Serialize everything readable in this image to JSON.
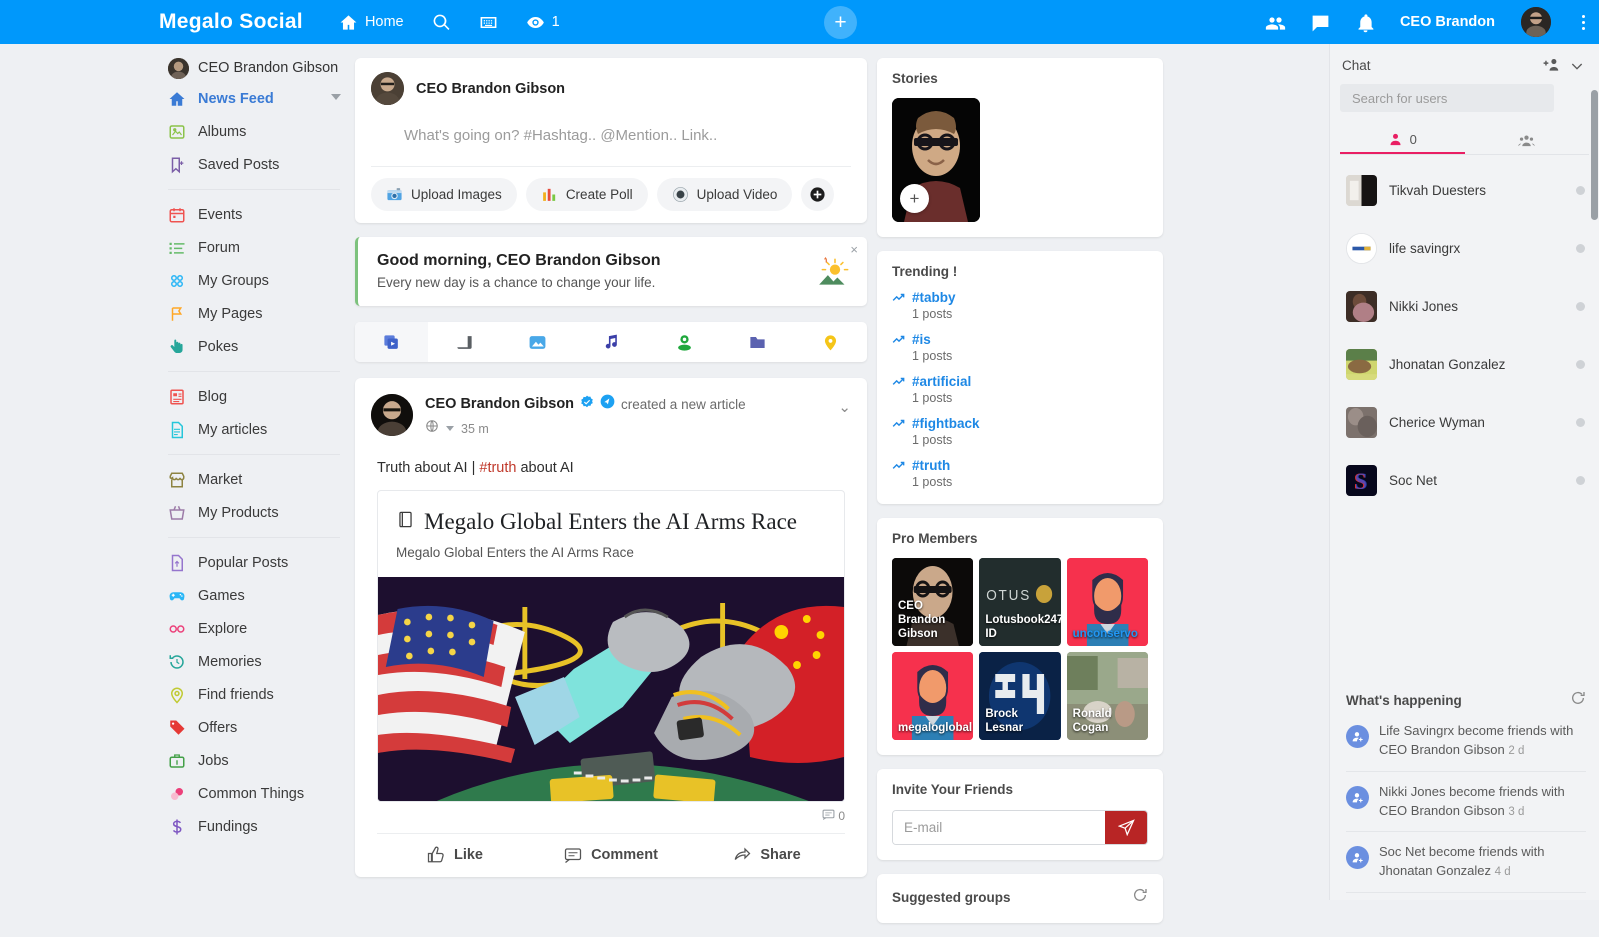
{
  "header": {
    "brand": "Megalo Social",
    "home_label": "Home",
    "search_icon": "search-icon",
    "keyboard_icon": "keyboard-icon",
    "eye_icon": "eye-icon",
    "eye_count": "1",
    "add_label": "+",
    "friends_icon": "friends-icon",
    "messages_icon": "messages-icon",
    "notifications_icon": "bell-icon",
    "user_name": "CEO Brandon",
    "accent_color": "#0098fb"
  },
  "sidebar": {
    "user": "CEO Brandon Gibson",
    "groups": [
      {
        "items": [
          {
            "label": "News Feed",
            "icon": "home-icon",
            "active": true,
            "color": "#3a7bd5"
          },
          {
            "label": "Albums",
            "icon": "albums-icon",
            "active": false,
            "color": "#8bc34a"
          },
          {
            "label": "Saved Posts",
            "icon": "bookmark-icon",
            "active": false,
            "color": "#7b5ea7"
          }
        ]
      },
      {
        "items": [
          {
            "label": "Events",
            "icon": "calendar-icon",
            "active": false,
            "color": "#ef5350"
          },
          {
            "label": "Forum",
            "icon": "list-icon",
            "active": false,
            "color": "#66bb6a"
          },
          {
            "label": "My Groups",
            "icon": "groups-icon",
            "active": false,
            "color": "#29b6f6"
          },
          {
            "label": "My Pages",
            "icon": "flag-icon",
            "active": false,
            "color": "#ffa726"
          },
          {
            "label": "Pokes",
            "icon": "hand-icon",
            "active": false,
            "color": "#26a69a"
          }
        ]
      },
      {
        "items": [
          {
            "label": "Blog",
            "icon": "blog-icon",
            "active": false,
            "color": "#ef5350"
          },
          {
            "label": "My articles",
            "icon": "article-icon",
            "active": false,
            "color": "#26c6da"
          }
        ]
      },
      {
        "items": [
          {
            "label": "Market",
            "icon": "market-icon",
            "active": false,
            "color": "#8d8341"
          },
          {
            "label": "My Products",
            "icon": "basket-icon",
            "active": false,
            "color": "#9c7ba8"
          }
        ]
      },
      {
        "items": [
          {
            "label": "Popular Posts",
            "icon": "popular-icon",
            "active": false,
            "color": "#9575cd"
          },
          {
            "label": "Games",
            "icon": "gamepad-icon",
            "active": false,
            "color": "#29b6f6"
          },
          {
            "label": "Explore",
            "icon": "explore-icon",
            "active": false,
            "color": "#ec407a"
          },
          {
            "label": "Memories",
            "icon": "memories-icon",
            "active": false,
            "color": "#26a69a"
          },
          {
            "label": "Find friends",
            "icon": "location-icon",
            "active": false,
            "color": "#c0ca33"
          },
          {
            "label": "Offers",
            "icon": "offers-icon",
            "active": false,
            "color": "#e53935"
          },
          {
            "label": "Jobs",
            "icon": "jobs-icon",
            "active": false,
            "color": "#43a047"
          },
          {
            "label": "Common Things",
            "icon": "common-icon",
            "active": false,
            "color": "#ec407a"
          },
          {
            "label": "Fundings",
            "icon": "dollar-icon",
            "active": false,
            "color": "#7e57c2"
          }
        ]
      }
    ]
  },
  "composer": {
    "user": "CEO Brandon Gibson",
    "placeholder": "What's going on? #Hashtag.. @Mention.. Link..",
    "tools": [
      {
        "label": "Upload Images",
        "icon": "camera-icon"
      },
      {
        "label": "Create Poll",
        "icon": "poll-icon"
      },
      {
        "label": "Upload Video",
        "icon": "video-icon"
      }
    ],
    "more_label": "+"
  },
  "greeting": {
    "title": "Good morning, CEO Brandon Gibson",
    "subtitle": "Every new day is a chance to change your life.",
    "close_label": "×",
    "icon": "sunrise-icon"
  },
  "feed_tabs": [
    {
      "icon": "all-posts-icon",
      "selected": true
    },
    {
      "icon": "text-post-icon",
      "selected": false
    },
    {
      "icon": "photo-icon",
      "selected": false
    },
    {
      "icon": "music-icon",
      "selected": false
    },
    {
      "icon": "live-icon",
      "selected": false
    },
    {
      "icon": "files-icon",
      "selected": false
    },
    {
      "icon": "map-pin-icon",
      "selected": false
    }
  ],
  "post": {
    "author": "CEO Brandon Gibson",
    "verified_icon": "verified-badge-icon",
    "pro_icon": "pro-badge-icon",
    "action": "created a new article",
    "privacy_icon": "globe-icon",
    "time": "35 m",
    "chevron": "⌄",
    "text_before": "Truth about AI | ",
    "hashtag": "#truth",
    "text_after": " about AI",
    "article_title": "Megalo Global Enters the AI Arms Race",
    "article_subtitle": "Megalo Global Enters the AI Arms Race",
    "article_icon": "book-icon",
    "comment_count": "0",
    "actions": [
      {
        "label": "Like",
        "icon": "thumbs-up-icon"
      },
      {
        "label": "Comment",
        "icon": "comment-icon"
      },
      {
        "label": "Share",
        "icon": "share-icon"
      }
    ]
  },
  "stories": {
    "title": "Stories",
    "add_label": "+"
  },
  "trending": {
    "title": "Trending !",
    "items": [
      {
        "tag": "#tabby",
        "count": "1 posts"
      },
      {
        "tag": "#is",
        "count": "1 posts"
      },
      {
        "tag": "#artificial",
        "count": "1 posts"
      },
      {
        "tag": "#fightback",
        "count": "1 posts"
      },
      {
        "tag": "#truth",
        "count": "1 posts"
      }
    ]
  },
  "pro_members": {
    "title": "Pro Members",
    "items": [
      {
        "name": "CEO Brandon Gibson",
        "bg": "#120f0d",
        "name_color": "white"
      },
      {
        "name": "Lotusbook247 ID",
        "bg": "#23302f",
        "name_color": "white"
      },
      {
        "name": "unconservo",
        "bg": "#f6314d",
        "name_color": "blue"
      },
      {
        "name": "megaloglobal",
        "bg": "#f6314d",
        "name_color": "white"
      },
      {
        "name": "Brock Lesnar",
        "bg": "#0d2a52",
        "name_color": "white"
      },
      {
        "name": "Ronald Cogan",
        "bg": "#7e8a6a",
        "name_color": "white"
      }
    ]
  },
  "invite": {
    "title": "Invite Your Friends",
    "placeholder": "E-mail",
    "value": "",
    "send_icon": "send-icon",
    "button_color": "#b82525"
  },
  "suggested_groups": {
    "title": "Suggested groups",
    "refresh_icon": "refresh-icon"
  },
  "chat": {
    "title": "Chat",
    "add_people_icon": "add-people-icon",
    "collapse_icon": "chevron-down-icon",
    "search_placeholder": "Search for users",
    "search_value": "",
    "tabs": [
      {
        "icon": "person-icon",
        "count": "0",
        "selected": true
      },
      {
        "icon": "group-icon",
        "count": "",
        "selected": false
      }
    ],
    "users": [
      {
        "name": "Tikvah Duesters",
        "bg": "#d8d4cf",
        "status": "offline"
      },
      {
        "name": "life savingrx",
        "bg": "#ffffff",
        "status": "offline"
      },
      {
        "name": "Nikki Jones",
        "bg": "#4d3a33",
        "status": "offline"
      },
      {
        "name": "Jhonatan Gonzalez",
        "bg": "#6f8a4a",
        "status": "offline"
      },
      {
        "name": "Cherice Wyman",
        "bg": "#7a6e69",
        "status": "offline"
      },
      {
        "name": "Soc Net",
        "bg": "#0a0a1e",
        "status": "offline"
      }
    ]
  },
  "whats_happening": {
    "title": "What's happening",
    "refresh_icon": "refresh-icon",
    "items": [
      {
        "text": "Life Savingrx become friends with CEO Brandon Gibson",
        "ago": "2 d"
      },
      {
        "text": "Nikki Jones become friends with CEO Brandon Gibson",
        "ago": "3 d"
      },
      {
        "text": "Soc Net become friends with Jhonatan Gonzalez",
        "ago": "4 d"
      }
    ]
  }
}
